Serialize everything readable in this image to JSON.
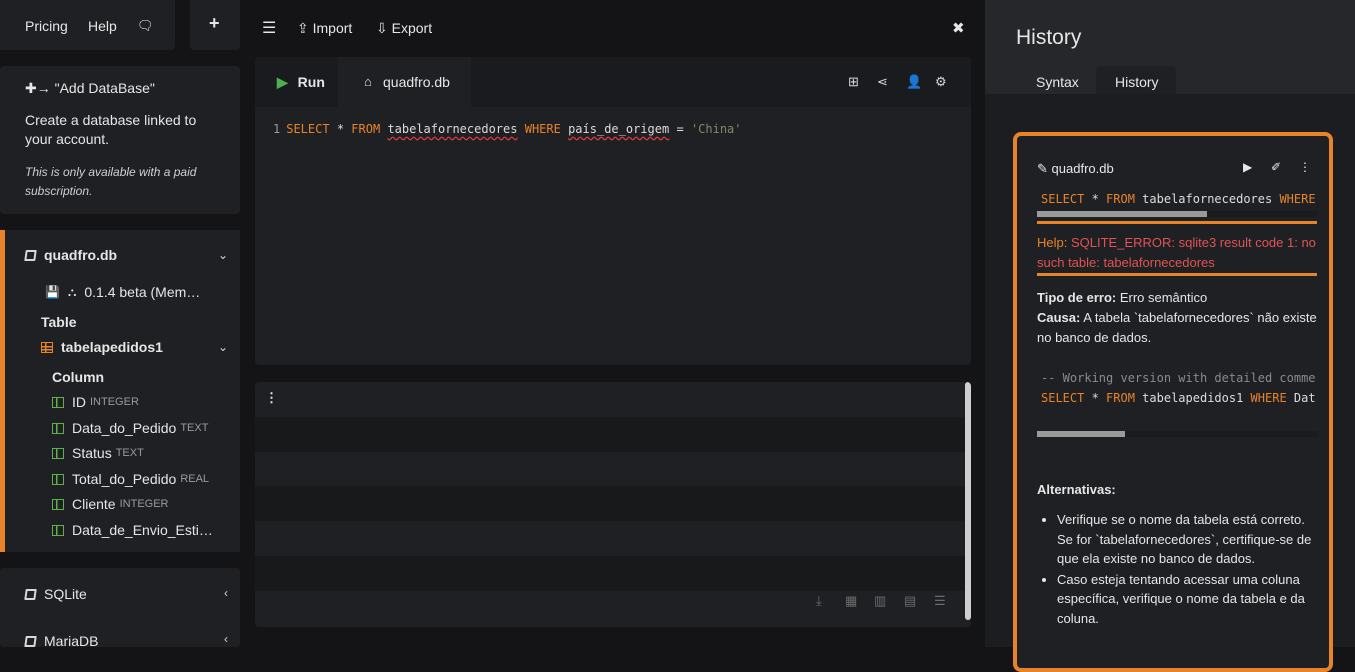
{
  "topnav": {
    "pricing": "Pricing",
    "help": "Help",
    "add": "+"
  },
  "adddb": {
    "title": "\"Add DataBase\"",
    "description": "Create a database linked to your account.",
    "note": "This is only available with a paid subscription."
  },
  "db": {
    "name": "quadfro.db",
    "version": "0.1.4 beta (Mem…",
    "table_header": "Table",
    "table_name": "tabelapedidos1",
    "column_header": "Column",
    "columns": [
      {
        "name": "ID",
        "type": "INTEGER"
      },
      {
        "name": "Data_do_Pedido",
        "type": "TEXT"
      },
      {
        "name": "Status",
        "type": "TEXT"
      },
      {
        "name": "Total_do_Pedido",
        "type": "REAL"
      },
      {
        "name": "Cliente",
        "type": "INTEGER"
      },
      {
        "name": "Data_de_Envio_Esti…",
        "type": ""
      }
    ]
  },
  "engines": {
    "sqlite": "SQLite",
    "mariadb": "MariaDB"
  },
  "toolbar": {
    "import": "Import",
    "export": "Export"
  },
  "editor": {
    "run": "Run",
    "tab": "quadfro.db",
    "line_no": "1",
    "kw_select": "SELECT",
    "star": "*",
    "kw_from": "FROM",
    "table": "tabelafornecedores",
    "kw_where": "WHERE",
    "column": "país_de_origem",
    "op": "=",
    "value": "'China'"
  },
  "history": {
    "title": "History",
    "tab_syntax": "Syntax",
    "tab_history": "History",
    "card_db": "quadfro.db",
    "sql_select": "SELECT",
    "sql_rest1": " * ",
    "sql_from": "FROM",
    "sql_table": " tabelafornecedores ",
    "sql_where": "WHERE",
    "help_label": "Help:",
    "help_text": " SQLITE_ERROR: sqlite3 result code 1: no such table: tabelafornecedores",
    "tipo_label": "Tipo de erro:",
    "tipo_value": " Erro semântico",
    "causa_label": "Causa:",
    "causa_value": " A tabela `tabelafornecedores` não existe no banco de dados.",
    "comment": "-- Working version with detailed comme",
    "sql2_select": "SELECT",
    "sql2_star": " * ",
    "sql2_from": "FROM",
    "sql2_table": " tabelapedidos1 ",
    "sql2_where": "WHERE",
    "sql2_tail": " Dat",
    "alt_title": "Alternativas:",
    "alt_items": [
      "Verifique se o nome da tabela está correto. Se for `tabelafornecedores`, certifique-se de que ela existe no banco de dados.",
      "Caso esteja tentando acessar uma coluna específica, verifique o nome da tabela e da coluna."
    ]
  },
  "colors": {
    "accent": "#e8832a",
    "error": "#e05353",
    "run": "#4caf50"
  }
}
